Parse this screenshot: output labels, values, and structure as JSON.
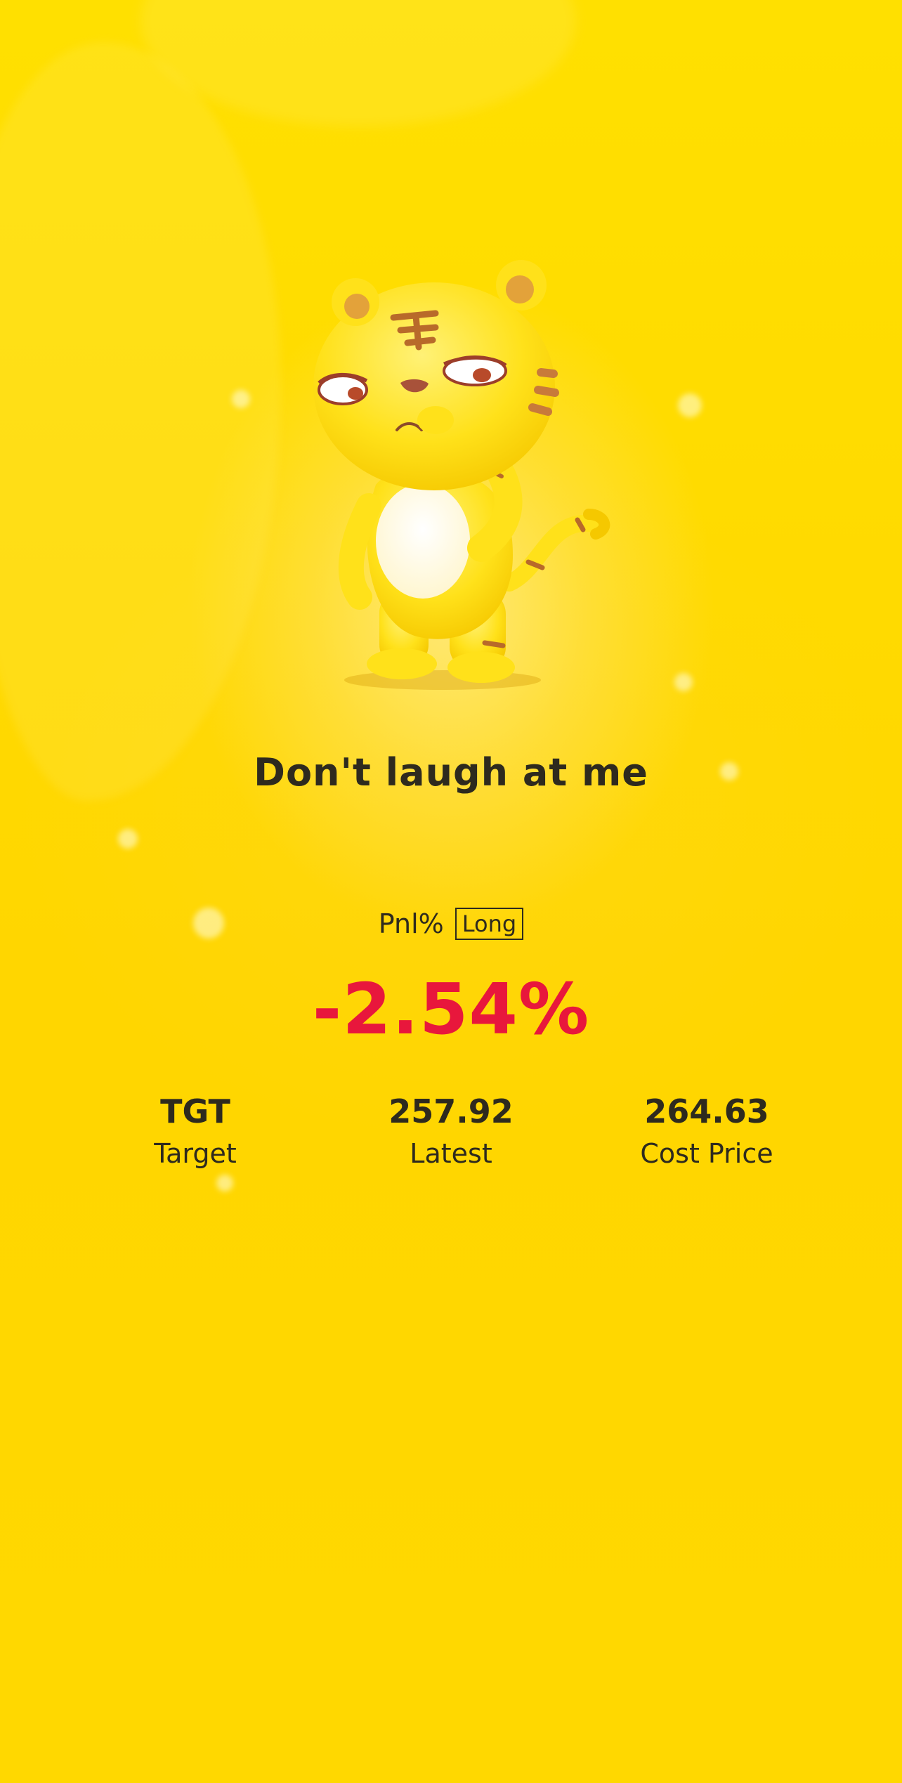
{
  "headline": "Don't laugh at me",
  "pnl": {
    "label": "Pnl%",
    "direction": "Long",
    "value": "-2.54%"
  },
  "stats": [
    {
      "value": "TGT",
      "label": "Target"
    },
    {
      "value": "257.92",
      "label": "Latest"
    },
    {
      "value": "264.63",
      "label": "Cost Price"
    }
  ],
  "colors": {
    "background": "#FFD800",
    "text": "#2E2A1E",
    "loss": "#E8173C"
  },
  "mascot": {
    "icon": "tiger-mascot-icon"
  }
}
